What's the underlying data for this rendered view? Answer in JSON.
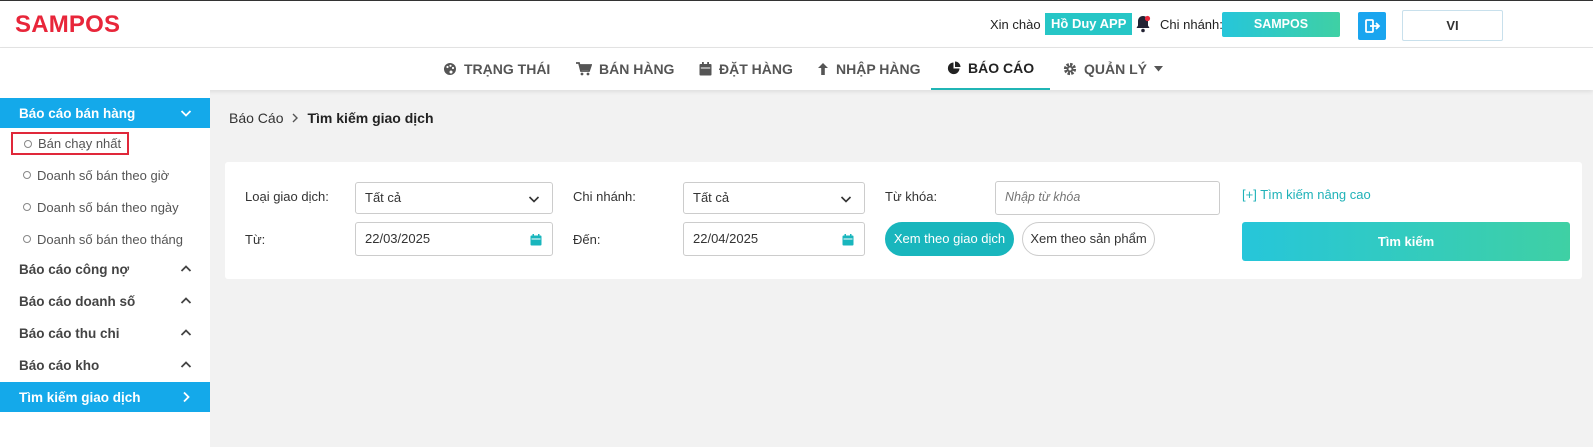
{
  "header": {
    "logo": "SAMPOS",
    "greeting": "Xin chào",
    "user_name": "Hồ Duy APP",
    "branch_label": "Chi nhánh:",
    "branch_value": "SAMPOS",
    "language": "VI"
  },
  "nav": {
    "items": [
      {
        "label": "TRẠNG THÁI",
        "icon": "palette-icon"
      },
      {
        "label": "BÁN HÀNG",
        "icon": "cart-icon"
      },
      {
        "label": "ĐẶT HÀNG",
        "icon": "calendar-icon"
      },
      {
        "label": "NHẬP HÀNG",
        "icon": "arrow-up-icon"
      },
      {
        "label": "BÁO CÁO",
        "icon": "pie-chart-icon",
        "active": true
      },
      {
        "label": "QUẢN LÝ",
        "icon": "gear-icon"
      }
    ]
  },
  "sidebar": {
    "groups": [
      {
        "label": "Báo cáo bán hàng",
        "expanded": true,
        "active": true
      },
      {
        "label": "Báo cáo công nợ"
      },
      {
        "label": "Báo cáo doanh số"
      },
      {
        "label": "Báo cáo thu chi"
      },
      {
        "label": "Báo cáo kho"
      },
      {
        "label": "Tìm kiếm giao dịch",
        "active": true
      }
    ],
    "sub_items": [
      {
        "label": "Bán chạy nhất",
        "highlighted": true
      },
      {
        "label": "Doanh số bán theo giờ"
      },
      {
        "label": "Doanh số bán theo ngày"
      },
      {
        "label": "Doanh số bán theo tháng"
      }
    ]
  },
  "breadcrumb": {
    "parent": "Báo Cáo",
    "current": "Tìm kiếm giao dịch"
  },
  "search": {
    "type_label": "Loại giao dịch:",
    "type_value": "Tất cả",
    "branch_label": "Chi nhánh:",
    "branch_value": "Tất cả",
    "keyword_label": "Từ khóa:",
    "keyword_placeholder": "Nhập từ khóa",
    "advanced_link": "[+] Tìm kiếm nâng cao",
    "from_label": "Từ:",
    "from_value": "22/03/2025",
    "to_label": "Đến:",
    "to_value": "22/04/2025",
    "view_by_transaction": "Xem theo giao dịch",
    "view_by_product": "Xem theo sản phẩm",
    "submit": "Tìm kiếm"
  },
  "colors": {
    "brand": "#e8263a",
    "sidebar_active": "#14a9ea",
    "teal": "#19b6bd",
    "highlight_box": "#e0283a"
  }
}
